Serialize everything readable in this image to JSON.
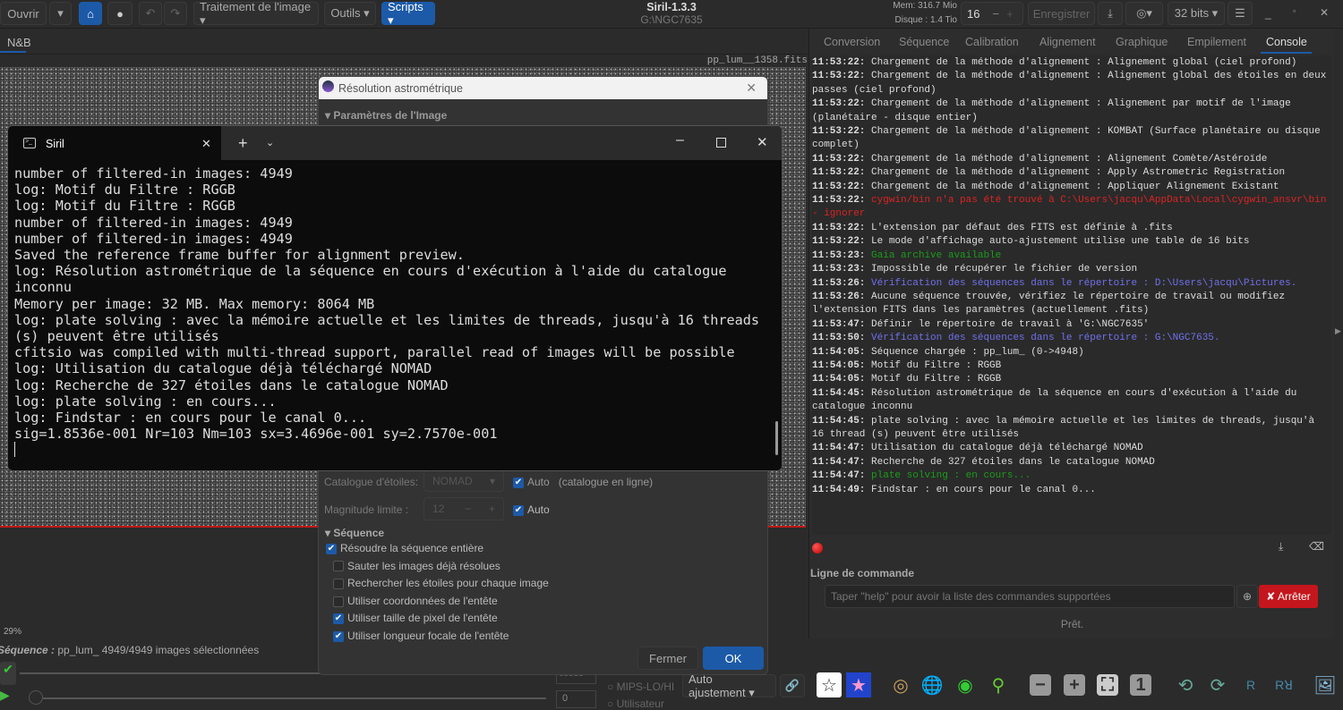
{
  "toolbar": {
    "open": "Ouvrir",
    "image_processing": "Traitement de l'image ▾",
    "tools": "Outils ▾",
    "scripts": "Scripts ▾",
    "app_title": "Siril-1.3.3",
    "working_dir": "G:\\NGC7635",
    "mem": "Mem: 316.7 Mio",
    "disk": "Disque : 1.4 Tio",
    "threads": "16",
    "save": "Enregistrer",
    "bit_depth": "32 bits ▾"
  },
  "image_tab": "N&B",
  "filename": "pp_lum__1358.fits",
  "zoom": "29%",
  "sequence_label": "Séquence :",
  "sequence_info": "pp_lum_ 4949/4949 images sélectionnées",
  "sliders": {
    "max_value": "65535",
    "min_value": "0",
    "mips": "MIPS-LO/HI",
    "user": "Utilisateur",
    "stretch": "Auto ajustement ▾"
  },
  "right_tabs": [
    "Conversion",
    "Séquence",
    "Calibration",
    "Alignement",
    "Graphique",
    "Empilement",
    "Console"
  ],
  "console": [
    {
      "t": "11:53:22:",
      "m": "Chargement de la méthode d'alignement : Alignement global (ciel profond)",
      "c": ""
    },
    {
      "t": "11:53:22:",
      "m": "Chargement de la méthode d'alignement : Alignement global des étoiles en deux passes (ciel profond)",
      "c": ""
    },
    {
      "t": "11:53:22:",
      "m": "Chargement de la méthode d'alignement : Alignement par motif de l'image (planétaire - disque entier)",
      "c": ""
    },
    {
      "t": "11:53:22:",
      "m": "Chargement de la méthode d'alignement : KOMBAT (Surface planétaire ou disque complet)",
      "c": ""
    },
    {
      "t": "11:53:22:",
      "m": "Chargement de la méthode d'alignement : Alignement Comète/Astéroïde",
      "c": ""
    },
    {
      "t": "11:53:22:",
      "m": "Chargement de la méthode d'alignement : Apply Astrometric Registration",
      "c": ""
    },
    {
      "t": "11:53:22:",
      "m": "Chargement de la méthode d'alignement : Appliquer Alignement Existant",
      "c": ""
    },
    {
      "t": "11:53:22:",
      "m": "cygwin/bin n'a pas été trouvé à C:\\Users\\jacqu\\AppData\\Local\\cygwin_ansvr\\bin - ignorer",
      "c": "red"
    },
    {
      "t": "11:53:22:",
      "m": "L'extension par défaut des FITS est définie à .fits",
      "c": ""
    },
    {
      "t": "11:53:22:",
      "m": "Le mode d'affichage auto-ajustement utilise une table de 16 bits",
      "c": ""
    },
    {
      "t": "11:53:23:",
      "m": "Gaia archive available",
      "c": "grn"
    },
    {
      "t": "11:53:23:",
      "m": "Impossible de récupérer le fichier de version",
      "c": ""
    },
    {
      "t": "11:53:26:",
      "m": "Vérification des séquences dans le répertoire : D:\\Users\\jacqu\\Pictures.",
      "c": "blu"
    },
    {
      "t": "11:53:26:",
      "m": "Aucune séquence trouvée, vérifiez le répertoire de travail ou modifiez l'extension FITS dans les paramètres (actuellement .fits)",
      "c": ""
    },
    {
      "t": "11:53:47:",
      "m": "Définir le répertoire de travail à 'G:\\NGC7635'",
      "c": ""
    },
    {
      "t": "11:53:50:",
      "m": "Vérification des séquences dans le répertoire : G:\\NGC7635.",
      "c": "blu"
    },
    {
      "t": "11:54:05:",
      "m": "Séquence chargée : pp_lum_ (0->4948)",
      "c": ""
    },
    {
      "t": "11:54:05:",
      "m": "Motif du Filtre : RGGB",
      "c": ""
    },
    {
      "t": "11:54:05:",
      "m": "Motif du Filtre : RGGB",
      "c": ""
    },
    {
      "t": "11:54:45:",
      "m": "Résolution astrométrique de la séquence en cours d'exécution à l'aide du catalogue inconnu",
      "c": ""
    },
    {
      "t": "11:54:45:",
      "m": "plate solving : avec la mémoire actuelle et les limites de threads, jusqu'à 16 thread (s) peuvent être utilisés",
      "c": ""
    },
    {
      "t": "11:54:47:",
      "m": "Utilisation du catalogue déjà téléchargé NOMAD",
      "c": ""
    },
    {
      "t": "11:54:47:",
      "m": "Recherche de 327 étoiles dans le catalogue NOMAD",
      "c": ""
    },
    {
      "t": "11:54:47:",
      "m": "plate solving : en cours...",
      "c": "grn"
    },
    {
      "t": "11:54:49:",
      "m": "Findstar : en cours pour le canal 0...",
      "c": ""
    }
  ],
  "command": {
    "label": "Ligne de commande",
    "placeholder": "Taper \"help\" pour avoir la liste des commandes supportées",
    "stop": "✘ Arrêter",
    "status": "Prêt."
  },
  "dialog": {
    "title": "Résolution astrométrique",
    "section_image": "Paramètres de l'Image",
    "catalog_label": "Catalogue d'étoiles:",
    "catalog_value": "NOMAD",
    "auto": "Auto",
    "online": "(catalogue en ligne)",
    "mag_label": "Magnitude limite :",
    "mag_value": "12",
    "section_seq": "Séquence",
    "options": [
      {
        "label": "Résoudre la séquence entière",
        "checked": true
      },
      {
        "label": "Sauter les images déjà résolues",
        "checked": false
      },
      {
        "label": "Rechercher les étoiles pour chaque image",
        "checked": false
      },
      {
        "label": "Utiliser coordonnées de l'entête",
        "checked": false
      },
      {
        "label": "Utiliser taille de pixel de l'entête",
        "checked": true
      },
      {
        "label": "Utiliser longueur focale de l'entête",
        "checked": true
      }
    ],
    "close": "Fermer",
    "ok": "OK"
  },
  "terminal": {
    "tab_title": "Siril",
    "lines": [
      "number of filtered-in images: 4949",
      "log: Motif du Filtre : RGGB",
      "log: Motif du Filtre : RGGB",
      "number of filtered-in images: 4949",
      "number of filtered-in images: 4949",
      "Saved the reference frame buffer for alignment preview.",
      "log: Résolution astrométrique de la séquence en cours d'exécution à l'aide du catalogue inconnu",
      "Memory per image: 32 MB. Max memory: 8064 MB",
      "log: plate solving : avec la mémoire actuelle et les limites de threads, jusqu'à 16 threads (s) peuvent être utilisés",
      "cfitsio was compiled with multi-thread support, parallel read of images will be possible",
      "log: Utilisation du catalogue déjà téléchargé NOMAD",
      "log: Recherche de 327 étoiles dans le catalogue NOMAD",
      "log: plate solving : en cours...",
      "log: Findstar : en cours pour le canal 0...",
      "sig=1.8536e-001 Nr=103 Nm=103 sx=3.4696e-001 sy=2.7570e-001"
    ]
  }
}
